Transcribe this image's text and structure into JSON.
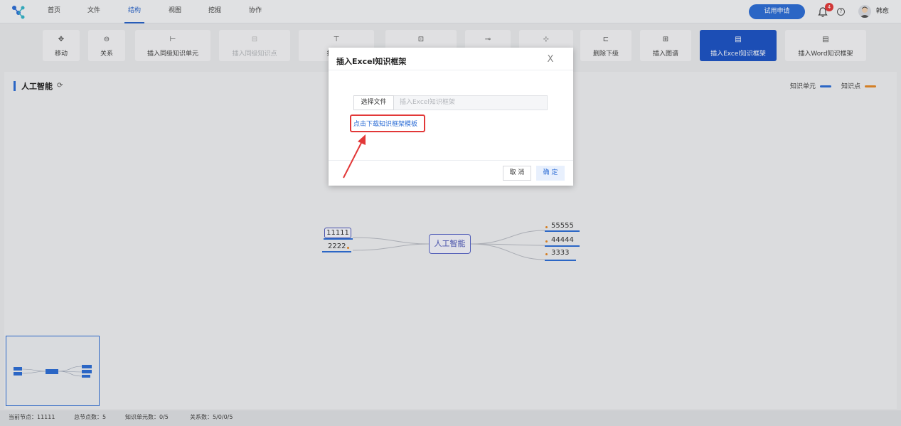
{
  "nav": {
    "items": [
      "首页",
      "文件",
      "结构",
      "视图",
      "挖掘",
      "协作"
    ],
    "active": "结构",
    "trial_button": "试用申请",
    "notification_count": "4",
    "help_symbol": "?",
    "user_name": "韩愈"
  },
  "toolbar": {
    "tools": [
      {
        "label": "移动",
        "icon": "move-icon",
        "state": "normal"
      },
      {
        "label": "关系",
        "icon": "relation-icon",
        "state": "normal"
      },
      {
        "label": "插入同级知识单元",
        "icon": "insert-sibling-unit-icon",
        "state": "normal"
      },
      {
        "label": "插入同级知识点",
        "icon": "insert-sibling-point-icon",
        "state": "disabled"
      },
      {
        "label": "插入下",
        "icon": "insert-child-icon",
        "state": "normal"
      },
      {
        "label": "",
        "icon": "structure-icon",
        "state": "normal"
      },
      {
        "label": "",
        "icon": "link-icon",
        "state": "normal"
      },
      {
        "label": "",
        "icon": "node-icon",
        "state": "normal"
      },
      {
        "label": "删除下级",
        "icon": "delete-child-icon",
        "state": "normal"
      },
      {
        "label": "插入图谱",
        "icon": "insert-graph-icon",
        "state": "normal"
      },
      {
        "label": "插入Excel知识框架",
        "icon": "excel-icon",
        "state": "active"
      },
      {
        "label": "插入Word知识框架",
        "icon": "word-icon",
        "state": "normal"
      }
    ]
  },
  "canvas": {
    "title": "人工智能",
    "legend": [
      {
        "label": "知识单元",
        "color": "#2f6fd6"
      },
      {
        "label": "知识点",
        "color": "#e58a2a"
      }
    ],
    "center_node": "人工智能",
    "left_nodes": [
      "11111",
      "2222"
    ],
    "right_nodes": [
      "55555",
      "44444",
      "3333"
    ]
  },
  "status": {
    "current_node": "当前节点：11111",
    "total_nodes": "总节点数：5",
    "knowledge_units": "知识单元数：0/5",
    "relations": "关系数：5/0/0/5"
  },
  "modal": {
    "title": "插入Excel知识框架",
    "close_symbol": "X",
    "choose_file": "选择文件",
    "file_placeholder": "插入Excel知识框架",
    "download_link": "点击下载知识框架模板",
    "cancel": "取 消",
    "ok": "确 定"
  },
  "colors": {
    "accent": "#2f6fd6",
    "active_tool": "#1f55c5",
    "point": "#e58a2a",
    "highlight": "#e23838"
  }
}
